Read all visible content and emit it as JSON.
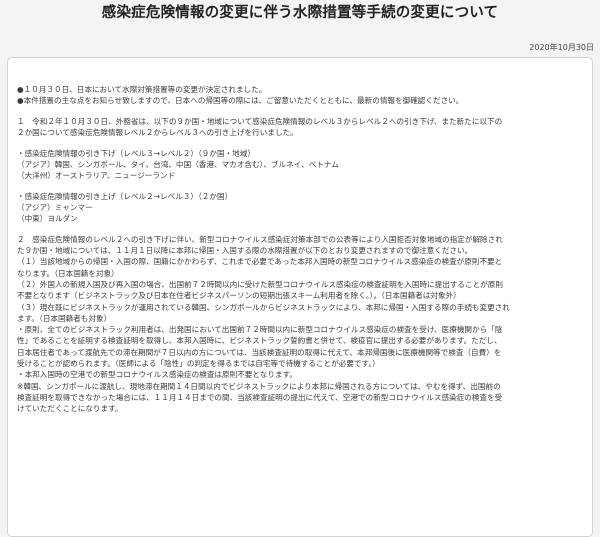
{
  "header": {
    "title": "感染症危険情報の変更に伴う水際措置等手続の変更について",
    "date": "2020年10月30日"
  },
  "notice": {
    "lines": [
      "●１０月３０日、日本において水際対策措置等の変更が決定されました。",
      "●本件措置の主な点をお知らせ致しますので、日本への帰国等の際には、ご留意いただくとともに、最新の情報を御確認ください。",
      "",
      "１　令和２年１０月３０日、外務省は、以下の９か国・地域について感染症危険情報のレベル３からレベル２への引き下げ、また新たに以下の",
      "２か国について感染症危険情報レベル２からレベル３への引き上げを行いました。",
      "",
      "・感染症危険情報の引き下げ（レベル３→レベル２）（９か国・地域）",
      "（アジア）韓国、シンガポール、タイ、台湾、中国（香港、マカオ含む）、ブルネイ、ベトナム",
      "（大洋州）オーストラリア、ニュージーランド",
      "",
      "・感染症危険情報の引き上げ（レベル２→レベル３）（２か国）",
      "（アジア）ミャンマー",
      "（中東）ヨルダン",
      "",
      "２　感染症危険情報のレベル２への引き下げに伴い、新型コロナウイルス感染症対策本部での公表等により入国拒否対象地域の指定が解除され",
      "た９か国・地域については、１１月１日以降に本邦に帰国・入国する際の水際措置が以下のとおり変更されますので御注意ください。",
      "（１）当該地域からの帰国・入国の際、国籍にかかわらず、これまで必要であった本邦入国時の新型コロナウイルス感染症の検査が原則不要と",
      "なります。（日本国籍を対象）",
      "（２）外国人の新規入国及び再入国の場合、出国前７２時間以内に受けた新型コロナウイルス感染症の検査証明を入国時に提出することが原則",
      "不要となります（ビジネストラック及び日本在住者ビジネスパーソンの短期出張スキーム利用者を除く。）。（日本国籍者は対象外）",
      "（３）現在既にビジネストラックが運用されている韓国、シンガポールからビジネストラックにより、本邦に帰国・入国する際の手続も変更され",
      "ます。（日本国籍者も対象）",
      "・原則、全てのビジネストラック利用者は、出発国において出国前７２時間以内に新型コロナウイルス感染症の検査を受け、医療機関から「陰",
      "性」であることを証明する検査証明を取得し、本邦入国時に、ビジネストラック誓約書と併せて、検疫官に提出する必要があります。ただし、",
      "日本居住者であって渡航先での滞在期間が７日以内の方については、当該検査証明の取得に代えて、本邦帰国後に医療機関等で検査（自費）を",
      "受けることが認められます。（医師による「陰性」の判定を得るまでは自宅等で待機することが必要です。）",
      "・本邦入国時の空港での新型コロナウイルス感染症の検査は原則不要となります。",
      "※韓国、シンガポールに渡航し、現地滞在期間１４日間以内でビジネストラックにより本邦に帰国される方については、やむを得ず、出国前の",
      "検査証明を取得できなかった場合には、１１月１４日までの間、当該検査証明の提出に代えて、空港での新型コロナウイルス感染症の検査を受",
      "けていただくことになります。"
    ]
  },
  "colors": {
    "page_background": "#f4f4f4",
    "box_background": "#ffffff",
    "box_border": "#d2d2d2",
    "text": "#3a3a3a"
  }
}
